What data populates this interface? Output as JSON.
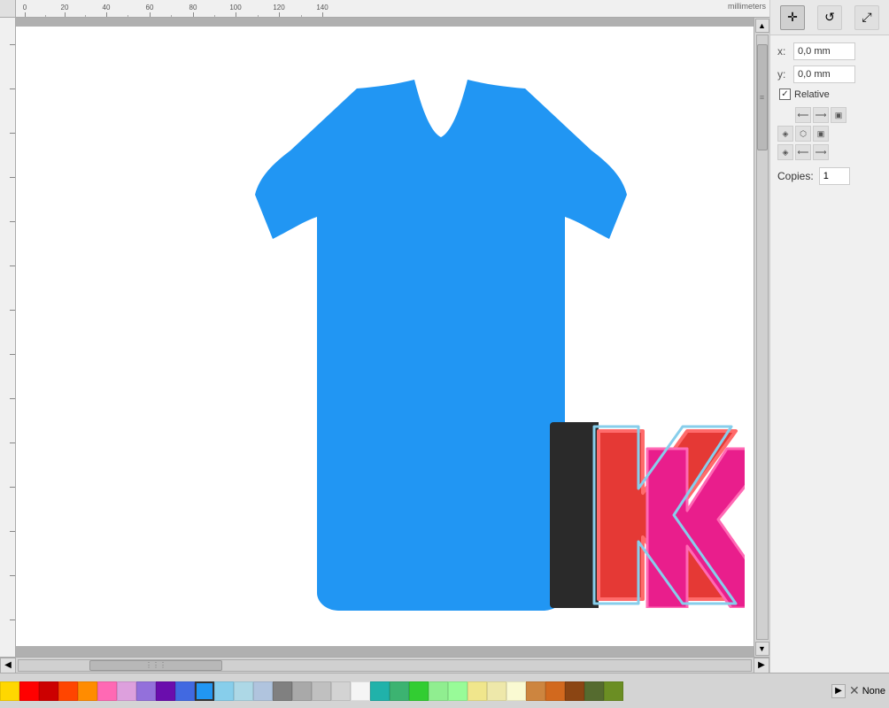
{
  "ruler": {
    "unit": "millimeters",
    "h_ticks": [
      0,
      20,
      40,
      60,
      80,
      100,
      120,
      140
    ],
    "v_ticks": []
  },
  "toolbar": {
    "move_icon": "+",
    "rotate_icon": "↺",
    "scale_icon": "⤢"
  },
  "panel": {
    "x_label": "x:",
    "y_label": "y:",
    "x_value": "0,0 mm",
    "y_value": "0,0 mm",
    "relative_checked": true,
    "relative_label": "Relative",
    "copies_label": "Copies:",
    "copies_value": "1"
  },
  "color_palette": [
    "#FFD700",
    "#FF0000",
    "#CC0000",
    "#FF4500",
    "#FF8C00",
    "#FF69B4",
    "#DDA0DD",
    "#9370DB",
    "#6A0DAD",
    "#4169E1",
    "#1E90FF",
    "#2196F3",
    "#00BFFF",
    "#87CEEB",
    "#B0C4DE",
    "#808080",
    "#A9A9A9",
    "#C0C0C0",
    "#D3D3D3",
    "#F5F5F5",
    "#20B2AA",
    "#3CB371",
    "#32CD32",
    "#90EE90",
    "#98FB98",
    "#F0E68C",
    "#EEE8AA",
    "#FAFAD2",
    "#FFFACD",
    "#FFFFE0",
    "#CD853F",
    "#D2691E",
    "#8B4513",
    "#A0522D",
    "#DEB887"
  ],
  "none_label": "None",
  "tshirt_color": "#2196F3",
  "scroll": {
    "h_position": "middle"
  }
}
